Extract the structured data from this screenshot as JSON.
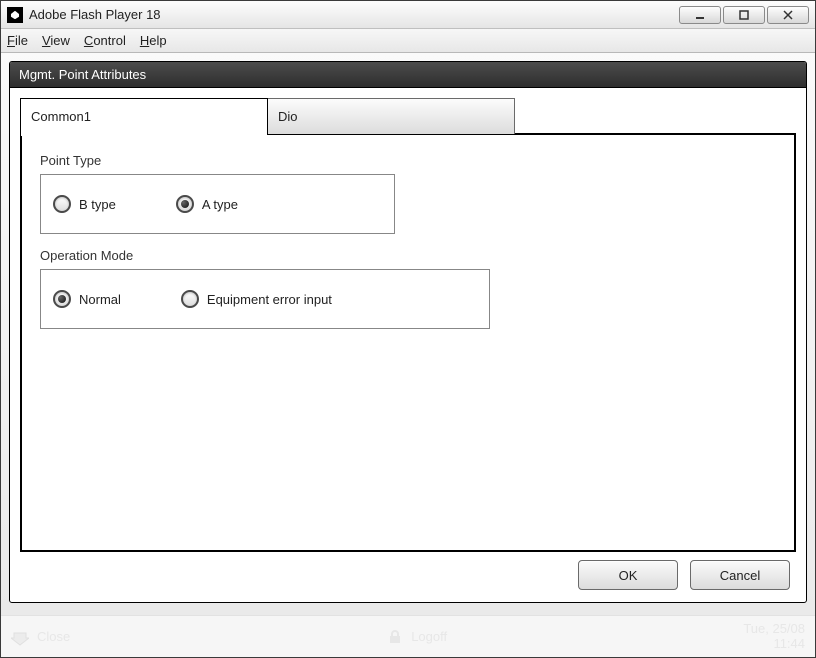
{
  "window": {
    "title": "Adobe Flash Player 18"
  },
  "menu": {
    "file": "File",
    "view": "View",
    "control": "Control",
    "help": "Help"
  },
  "panel": {
    "title": "Mgmt. Point Attributes",
    "tabs": {
      "common1": "Common1",
      "dio": "Dio"
    },
    "point_type": {
      "label": "Point Type",
      "options": {
        "b": "B type",
        "a": "A type"
      },
      "selected": "a"
    },
    "operation_mode": {
      "label": "Operation Mode",
      "options": {
        "normal": "Normal",
        "equip_err": "Equipment error input"
      },
      "selected": "normal"
    },
    "buttons": {
      "ok": "OK",
      "cancel": "Cancel"
    }
  },
  "bottom": {
    "close": "Close",
    "logoff": "Logoff",
    "date": "Tue, 25/08",
    "time": "11:44"
  }
}
